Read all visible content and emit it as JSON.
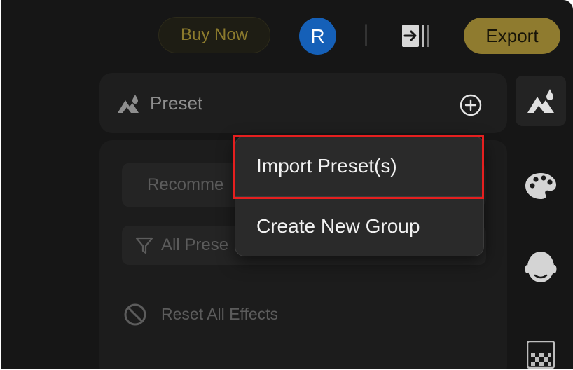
{
  "topbar": {
    "buy_now_label": "Buy Now",
    "avatar_initial": "R",
    "export_label": "Export"
  },
  "preset_panel": {
    "title": "Preset",
    "recommend_label": "Recomme",
    "filter_label": "All Prese",
    "reset_label": "Reset All Effects"
  },
  "menu": {
    "items": [
      {
        "label": "Import Preset(s)",
        "highlighted": true
      },
      {
        "label": "Create New Group",
        "highlighted": false
      }
    ]
  },
  "right_rail": {
    "items": [
      "preset-icon",
      "palette-icon",
      "face-icon",
      "texture-icon"
    ]
  },
  "colors": {
    "accent": "#8f7b2f",
    "avatar": "#1560b8",
    "highlight": "#e51f1f",
    "background": "#161616"
  }
}
